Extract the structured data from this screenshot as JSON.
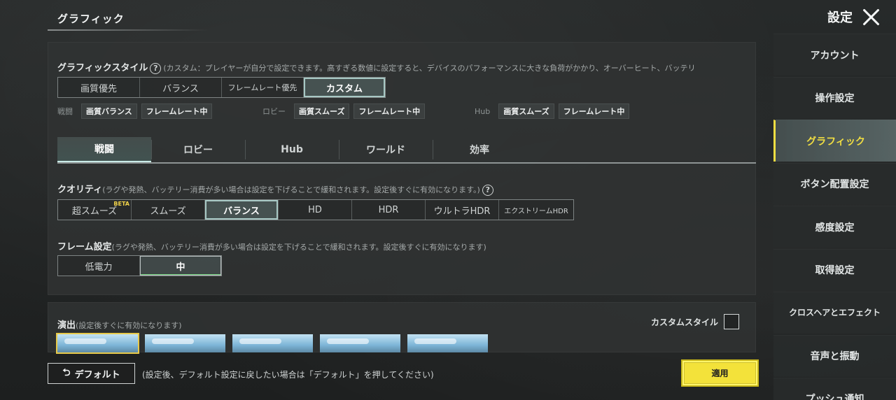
{
  "header": {
    "title": "グラフィック",
    "settings_label": "設定"
  },
  "graphic_style": {
    "label": "グラフィックスタイル",
    "note": "(カスタム：プレイヤーが自分で設定できます。高すぎる数値に設定すると、デバイスのパフォーマンスに大きな負荷がかかり、オーバーヒート、バッテリ",
    "options": [
      "画質優先",
      "バランス",
      "フレームレート優先",
      "カスタム"
    ],
    "selected": "カスタム"
  },
  "presets": [
    {
      "label": "戦闘",
      "quality": "画質バランス",
      "frame": "フレームレート中"
    },
    {
      "label": "ロビー",
      "quality": "画質スムーズ",
      "frame": "フレームレート中"
    },
    {
      "label": "Hub",
      "quality": "画質スムーズ",
      "frame": "フレームレート中"
    }
  ],
  "tabs": [
    "戦闘",
    "ロビー",
    "Hub",
    "ワールド",
    "効率"
  ],
  "active_tab": "戦闘",
  "quality": {
    "label": "クオリティ",
    "note": "(ラグや発熱、バッテリー消費が多い場合は設定を下げることで緩和されます。設定後すぐに有効になります。)",
    "options": [
      "超スムーズ",
      "スムーズ",
      "バランス",
      "HD",
      "HDR",
      "ウルトラHDR",
      "エクストリームHDR"
    ],
    "beta": "BETA",
    "selected": "バランス"
  },
  "frame": {
    "label": "フレーム設定",
    "note": "(ラグや発熱、バッテリー消費が多い場合は設定を下げることで緩和されます。設定後すぐに有効になります)",
    "options": [
      "低電力",
      "中"
    ],
    "selected": "中"
  },
  "rendering": {
    "label": "演出",
    "note": "(設定後すぐに有効になります)",
    "custom_style_label": "カスタムスタイル",
    "custom_style_checked": false
  },
  "bottom": {
    "default_label": "デフォルト",
    "default_note": "(設定後、デフォルト設定に戻したい場合は「デフォルト」を押してください)",
    "apply_label": "適用"
  },
  "sidebar": {
    "items": [
      "アカウント",
      "操作設定",
      "グラフィック",
      "ボタン配置設定",
      "感度設定",
      "取得設定",
      "クロスヘアとエフェクト",
      "音声と振動",
      "プッシュ通知"
    ],
    "active": "グラフィック"
  },
  "colors": {
    "accent_yellow": "#f1de42",
    "active_teal": "#a7c8c4",
    "apply_bg": "#f3e23a"
  }
}
